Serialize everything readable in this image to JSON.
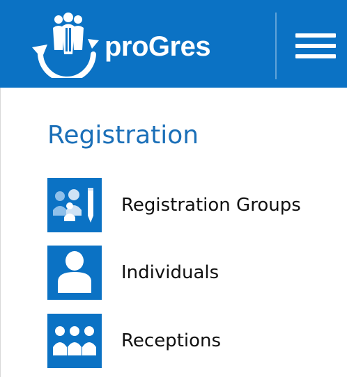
{
  "header": {
    "brand_name": "proGres",
    "logo_icon": "people-circle-icon",
    "menu_icon": "hamburger-menu-icon"
  },
  "colors": {
    "header_bg": "#0b72c4",
    "tile_bg": "#0b72c4",
    "section_title": "#1a6fb8",
    "label_text": "#111111"
  },
  "sidebar": {
    "section_title": "Registration",
    "items": [
      {
        "label": "Registration Groups",
        "icon": "registration-groups-icon"
      },
      {
        "label": "Individuals",
        "icon": "individual-person-icon"
      },
      {
        "label": "Receptions",
        "icon": "receptions-people-icon"
      }
    ]
  }
}
